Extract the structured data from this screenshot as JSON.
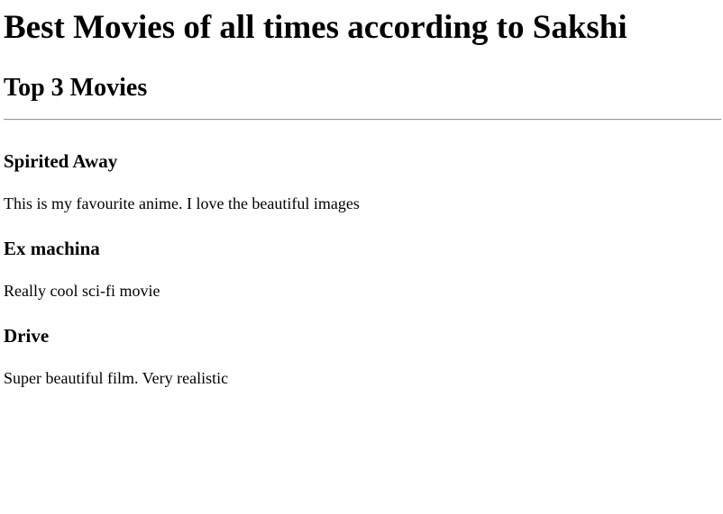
{
  "page": {
    "title": "Best Movies of all times according to Sakshi",
    "subtitle": "Top 3 Movies"
  },
  "movies": [
    {
      "title": "Spirited Away",
      "description": "This is my favourite anime. I love the beautiful images"
    },
    {
      "title": "Ex machina",
      "description": "Really cool sci-fi movie"
    },
    {
      "title": "Drive",
      "description": "Super beautiful film. Very realistic"
    }
  ]
}
